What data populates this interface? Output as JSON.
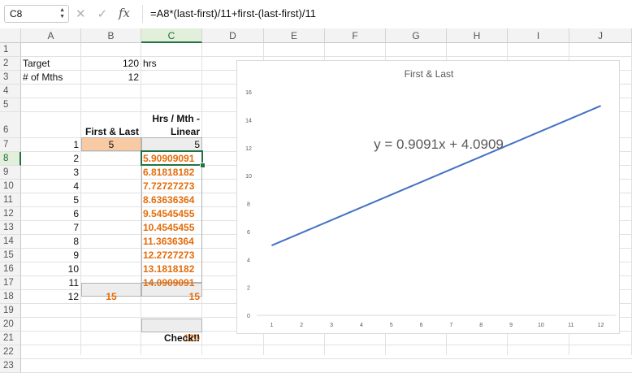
{
  "formula_bar": {
    "name_box": "C8",
    "fx_label": "fx",
    "formula": "=A8*(last-first)/11+first-(last-first)/11",
    "cancel_icon": "✕",
    "confirm_icon": "✓"
  },
  "columns": [
    "A",
    "B",
    "C",
    "D",
    "E",
    "F",
    "G",
    "H",
    "I",
    "J"
  ],
  "rows": [
    "1",
    "2",
    "3",
    "4",
    "5",
    "6",
    "7",
    "8",
    "9",
    "10",
    "11",
    "12",
    "13",
    "14",
    "15",
    "16",
    "17",
    "18",
    "19",
    "20",
    "21",
    "22",
    "23"
  ],
  "cells": {
    "A2": "Target",
    "B2": "120",
    "C2": "hrs",
    "A3": "# of Mths",
    "B3": "12",
    "B6": "First & Last",
    "C6_line1": "Hrs / Mth -",
    "C6_line2": "Linear",
    "A7": "1",
    "B7": "5",
    "C7": "5",
    "A8": "2",
    "C8": "5.90909091",
    "A9": "3",
    "C9": "6.81818182",
    "A10": "4",
    "C10": "7.72727273",
    "A11": "5",
    "C11": "8.63636364",
    "A12": "6",
    "C12": "9.54545455",
    "A13": "7",
    "C13": "10.4545455",
    "A14": "8",
    "C14": "11.3636364",
    "A15": "9",
    "C15": "12.2727273",
    "A16": "10",
    "C16": "13.1818182",
    "A17": "11",
    "C17": "14.0909091",
    "A18": "12",
    "B18": "15",
    "C18": "15",
    "C21": "120",
    "C22": "Check!!"
  },
  "chart_data": {
    "type": "line",
    "title": "First & Last",
    "annotation": "y = 0.9091x + 4.0909",
    "x": [
      1,
      2,
      3,
      4,
      5,
      6,
      7,
      8,
      9,
      10,
      11,
      12
    ],
    "series": [
      {
        "values": [
          5,
          5.90909091,
          6.81818182,
          7.72727273,
          8.63636364,
          9.54545455,
          10.4545455,
          11.3636364,
          12.2727273,
          13.1818182,
          14.0909091,
          15
        ]
      }
    ],
    "xticks": [
      "1",
      "2",
      "3",
      "4",
      "5",
      "6",
      "7",
      "8",
      "9",
      "10",
      "11",
      "12"
    ],
    "yticks": [
      "0",
      "2",
      "4",
      "6",
      "8",
      "10",
      "12",
      "14",
      "16"
    ],
    "ylim": [
      0,
      16
    ],
    "line_color": "#4472c4",
    "grid": false
  }
}
